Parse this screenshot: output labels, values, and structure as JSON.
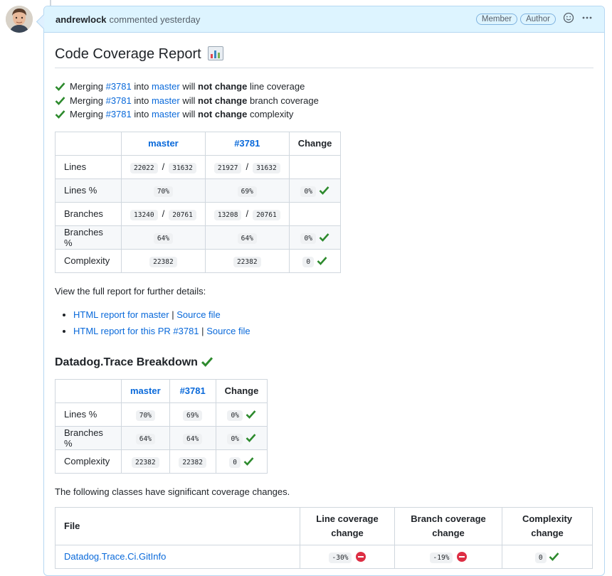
{
  "comment": {
    "author": "andrewlock",
    "action": "commented yesterday",
    "labels": [
      "Member",
      "Author"
    ]
  },
  "report": {
    "title": "Code Coverage Report",
    "merge_lines": [
      {
        "prefix": "Merging",
        "pr": "#3781",
        "into": "into",
        "branch": "master",
        "will": "will",
        "bold": "not change",
        "metric": "line coverage"
      },
      {
        "prefix": "Merging",
        "pr": "#3781",
        "into": "into",
        "branch": "master",
        "will": "will",
        "bold": "not change",
        "metric": "branch coverage"
      },
      {
        "prefix": "Merging",
        "pr": "#3781",
        "into": "into",
        "branch": "master",
        "will": "will",
        "bold": "not change",
        "metric": "complexity"
      }
    ],
    "summary_table": {
      "headers": [
        "",
        "master",
        "#3781",
        "Change"
      ],
      "rows": [
        {
          "label": "Lines",
          "master_a": "22022",
          "master_b": "31632",
          "pr_a": "21927",
          "pr_b": "31632",
          "change": ""
        },
        {
          "label": "Lines %",
          "master": "70%",
          "pr": "69%",
          "change": "0%"
        },
        {
          "label": "Branches",
          "master_a": "13240",
          "master_b": "20761",
          "pr_a": "13208",
          "pr_b": "20761",
          "change": ""
        },
        {
          "label": "Branches %",
          "master": "64%",
          "pr": "64%",
          "change": "0%"
        },
        {
          "label": "Complexity",
          "master": "22382",
          "pr": "22382",
          "change": "0"
        }
      ]
    },
    "details_text": "View the full report for further details:",
    "links": [
      {
        "text": "HTML report for master",
        "sep": "|",
        "source": "Source file"
      },
      {
        "text": "HTML report for this PR #3781",
        "sep": "|",
        "source": "Source file"
      }
    ],
    "breakdown_title": "Datadog.Trace Breakdown",
    "breakdown_table": {
      "headers": [
        "",
        "master",
        "#3781",
        "Change"
      ],
      "rows": [
        {
          "label": "Lines %",
          "master": "70%",
          "pr": "69%",
          "change": "0%"
        },
        {
          "label": "Branches %",
          "master": "64%",
          "pr": "64%",
          "change": "0%"
        },
        {
          "label": "Complexity",
          "master": "22382",
          "pr": "22382",
          "change": "0"
        }
      ]
    },
    "classes_text": "The following classes have significant coverage changes.",
    "classes_table": {
      "headers": [
        "File",
        "Line coverage change",
        "Branch coverage change",
        "Complexity change"
      ],
      "rows": [
        {
          "file": "Datadog.Trace.Ci.GitInfo",
          "line": "-30%",
          "branch": "-19%",
          "complexity": "0"
        }
      ]
    }
  },
  "colors": {
    "check": "#2d8a2d",
    "stop": "#dd2e44",
    "link": "#0969da"
  }
}
